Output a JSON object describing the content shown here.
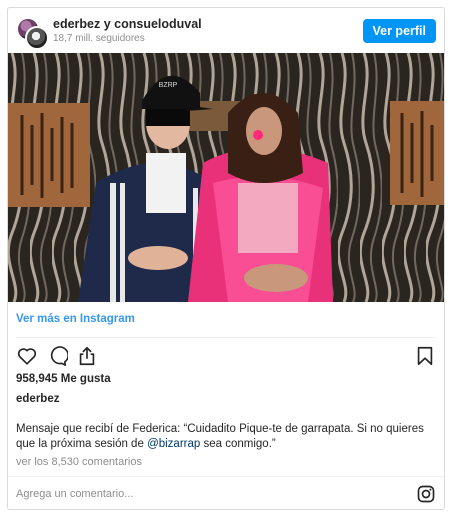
{
  "post": {
    "header": {
      "owner": "ederbez y consueloduval",
      "followers": "18,7 mill. seguidores",
      "view_profile_label": "Ver perfil"
    },
    "photo": {
      "cap_text": "BZRP"
    },
    "view_more_label": "Ver más en Instagram",
    "likes": "958,945 Me gusta",
    "author": "ederbez",
    "caption_before": "Mensaje que recibí de Federica: “Cuidadito Pique-te de garrapata. Si no quieres que la próxima sesión de ",
    "caption_mention": "@bizarrap",
    "caption_after": " sea conmigo.”",
    "comments_count": "ver los 8,530 comentarios",
    "comment_placeholder": "Agrega un comentario...",
    "icons": {
      "like": "heart-icon",
      "comment": "comment-bubble-icon",
      "share": "share-icon",
      "save": "bookmark-icon",
      "brand": "instagram-icon"
    },
    "colors": {
      "button": "#0095f6",
      "link": "#3897f0",
      "mention": "#00376b",
      "muted": "#8e8e8e"
    }
  }
}
